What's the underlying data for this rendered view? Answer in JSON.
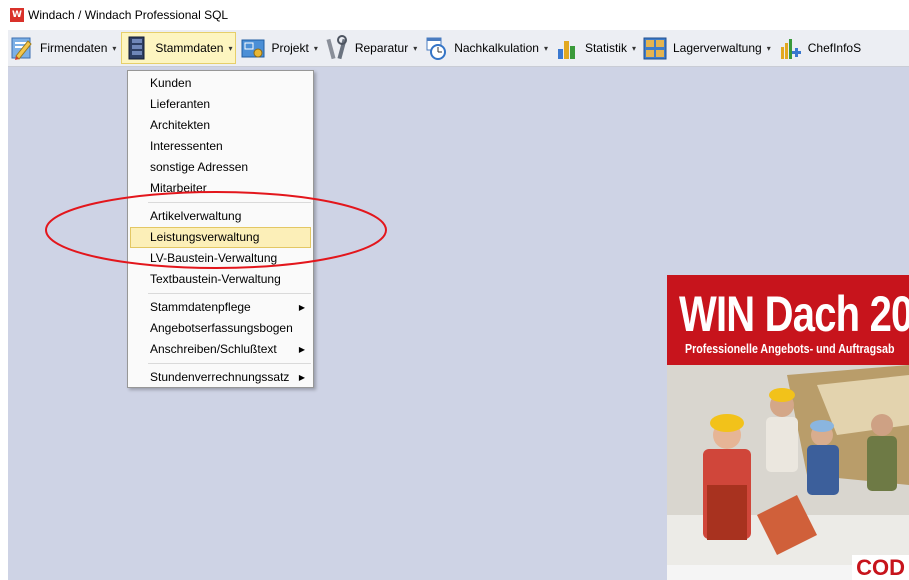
{
  "window": {
    "title": "Windach / Windach Professional SQL"
  },
  "toolbar": {
    "items": [
      {
        "label": "Firmendaten",
        "icon": "pencil-document-icon"
      },
      {
        "label": "Stammdaten",
        "icon": "binder-icon"
      },
      {
        "label": "Projekt",
        "icon": "blueprint-icon"
      },
      {
        "label": "Reparatur",
        "icon": "tools-icon"
      },
      {
        "label": "Nachkalkulation",
        "icon": "calendar-clock-icon"
      },
      {
        "label": "Statistik",
        "icon": "bar-chart-icon"
      },
      {
        "label": "Lagerverwaltung",
        "icon": "shelf-icon"
      },
      {
        "label": "ChefInfoS",
        "icon": "chart-plus-icon"
      }
    ]
  },
  "menu": {
    "items": [
      {
        "label": "Kunden"
      },
      {
        "label": "Lieferanten"
      },
      {
        "label": "Architekten"
      },
      {
        "label": "Interessenten"
      },
      {
        "label": "sonstige Adressen"
      },
      {
        "label": "Mitarbeiter"
      },
      {
        "label": "Artikelverwaltung"
      },
      {
        "label": "Leistungsverwaltung"
      },
      {
        "label": "LV-Baustein-Verwaltung"
      },
      {
        "label": "Textbaustein-Verwaltung"
      },
      {
        "label": "Stammdatenpflege"
      },
      {
        "label": "Angebotserfassungsbogen"
      },
      {
        "label": "Anschreiben/Schlußtext"
      },
      {
        "label": "Stundenverrechnungssatz"
      }
    ]
  },
  "banner": {
    "title": "WIN Dach 20",
    "subtitle": "Professionelle Angebots- und Auftragsab",
    "brand": "COD"
  },
  "colors": {
    "workspace": "#ced3e5",
    "highlight": "#fcefb8",
    "annotation": "#e3161c",
    "banner": "#c7141c"
  }
}
